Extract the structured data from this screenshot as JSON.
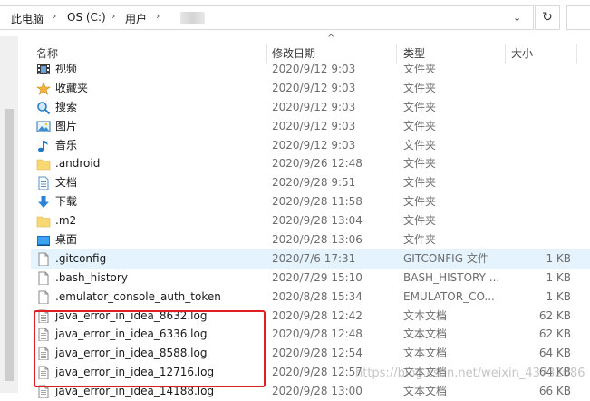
{
  "address": {
    "crumbs": [
      "此电脑",
      "OS (C:)",
      "用户"
    ],
    "separator": "›"
  },
  "header": {
    "name": "名称",
    "date": "修改日期",
    "type": "类型",
    "size": "大小",
    "sort_indicator": "^"
  },
  "rows": [
    {
      "icon": "video-folder-icon",
      "name": "视频",
      "date": "2020/9/12 9:03",
      "type": "文件夹",
      "size": ""
    },
    {
      "icon": "favorites-folder-icon",
      "name": "收藏夹",
      "date": "2020/9/12 9:03",
      "type": "文件夹",
      "size": ""
    },
    {
      "icon": "search-folder-icon",
      "name": "搜索",
      "date": "2020/9/12 9:03",
      "type": "文件夹",
      "size": ""
    },
    {
      "icon": "pictures-folder-icon",
      "name": "图片",
      "date": "2020/9/12 9:03",
      "type": "文件夹",
      "size": ""
    },
    {
      "icon": "music-folder-icon",
      "name": "音乐",
      "date": "2020/9/12 9:03",
      "type": "文件夹",
      "size": ""
    },
    {
      "icon": "folder-icon",
      "name": ".android",
      "date": "2020/9/26 12:48",
      "type": "文件夹",
      "size": ""
    },
    {
      "icon": "documents-folder-icon",
      "name": "文档",
      "date": "2020/9/28 9:51",
      "type": "文件夹",
      "size": ""
    },
    {
      "icon": "downloads-folder-icon",
      "name": "下载",
      "date": "2020/9/28 11:58",
      "type": "文件夹",
      "size": ""
    },
    {
      "icon": "folder-icon",
      "name": ".m2",
      "date": "2020/9/28 13:04",
      "type": "文件夹",
      "size": ""
    },
    {
      "icon": "desktop-folder-icon",
      "name": "桌面",
      "date": "2020/9/28 13:06",
      "type": "文件夹",
      "size": ""
    },
    {
      "icon": "file-icon",
      "name": ".gitconfig",
      "date": "2020/7/6 17:31",
      "type": "GITCONFIG 文件",
      "size": "1 KB",
      "selected": true
    },
    {
      "icon": "file-icon",
      "name": ".bash_history",
      "date": "2020/7/29 15:10",
      "type": "BASH_HISTORY ...",
      "size": "1 KB"
    },
    {
      "icon": "file-icon",
      "name": ".emulator_console_auth_token",
      "date": "2020/8/28 15:34",
      "type": "EMULATOR_CO...",
      "size": "1 KB"
    },
    {
      "icon": "text-file-icon",
      "name": "java_error_in_idea_8632.log",
      "date": "2020/9/28 12:42",
      "type": "文本文档",
      "size": "62 KB"
    },
    {
      "icon": "text-file-icon",
      "name": "java_error_in_idea_6336.log",
      "date": "2020/9/28 12:48",
      "type": "文本文档",
      "size": "62 KB"
    },
    {
      "icon": "text-file-icon",
      "name": "java_error_in_idea_8588.log",
      "date": "2020/9/28 12:54",
      "type": "文本文档",
      "size": "64 KB"
    },
    {
      "icon": "text-file-icon",
      "name": "java_error_in_idea_12716.log",
      "date": "2020/9/28 12:57",
      "type": "文本文档",
      "size": "64 KB"
    },
    {
      "icon": "text-file-icon",
      "name": "java_error_in_idea_14188.log",
      "date": "2020/9/28 13:00",
      "type": "文本文档",
      "size": "66 KB"
    }
  ],
  "watermark": "https://blog.csdn.net/weixin_43732086",
  "colors": {
    "selected_row": "#e5f3ff",
    "highlight_box": "#e02020",
    "folder": "#f8d775"
  }
}
